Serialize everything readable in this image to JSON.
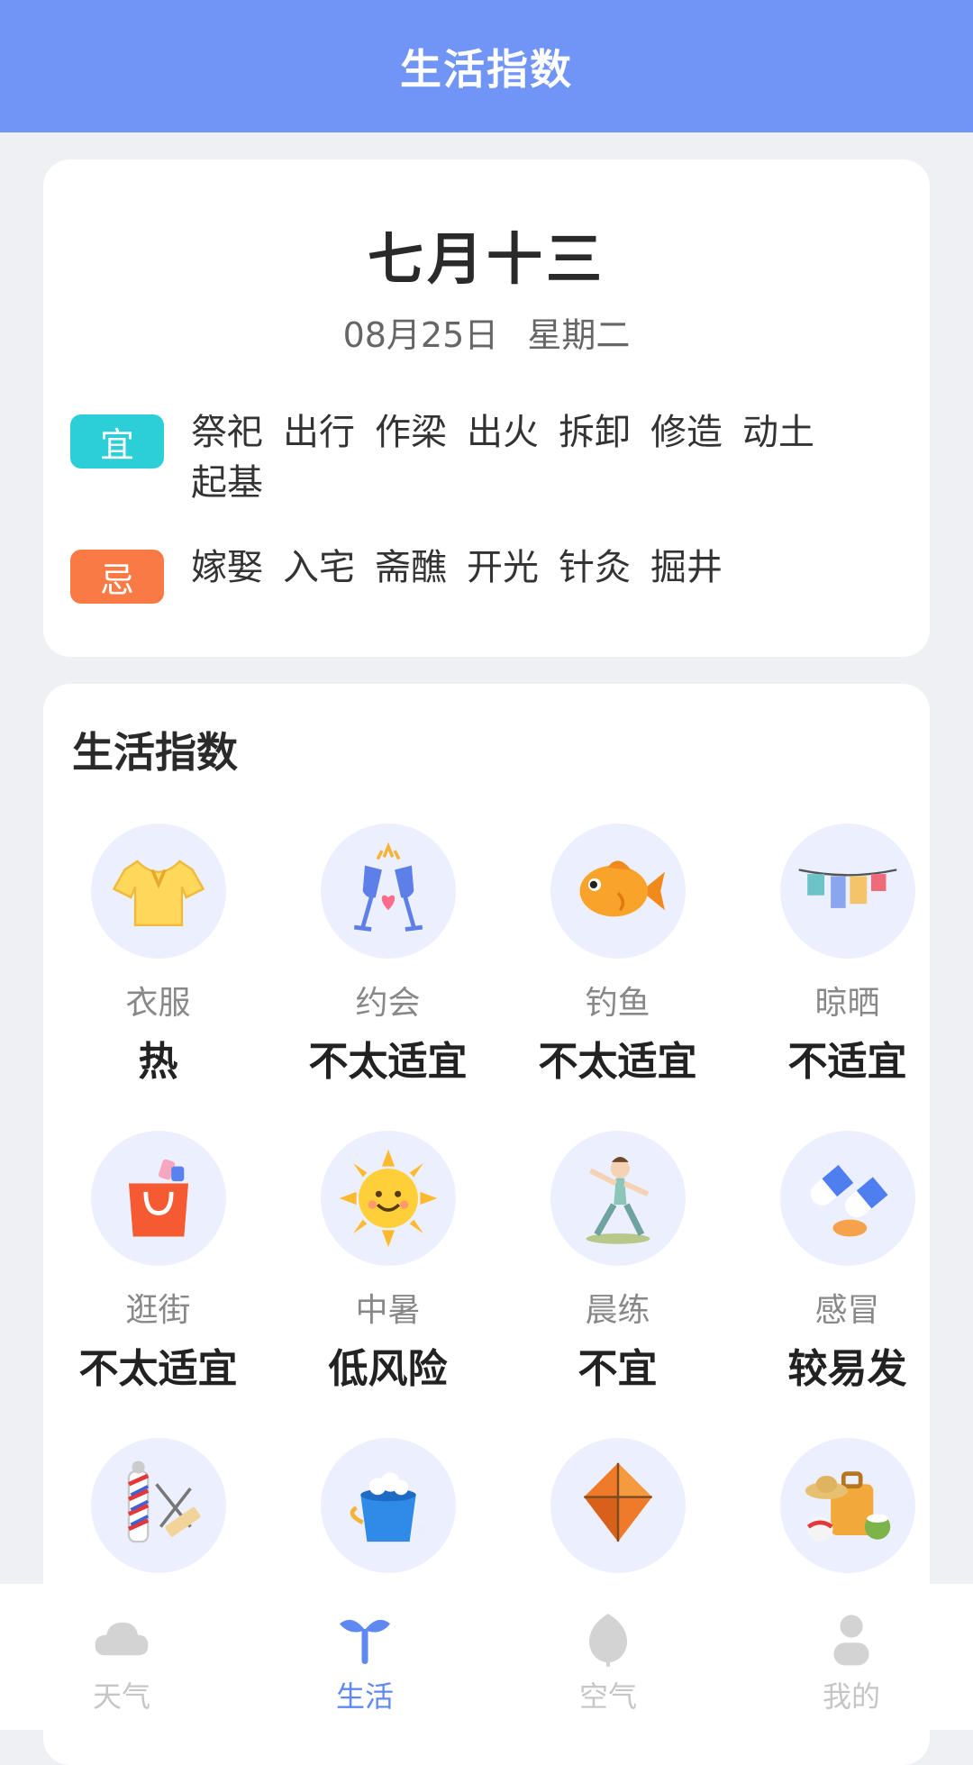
{
  "header": {
    "title": "生活指数"
  },
  "almanac": {
    "lunar_date": "七月十三",
    "solar_date": "08月25日",
    "weekday": "星期二",
    "yi_label": "宜",
    "yi_items": [
      "祭祀",
      "出行",
      "作梁",
      "出火",
      "拆卸",
      "修造",
      "动土",
      "起基"
    ],
    "ji_label": "忌",
    "ji_items": [
      "嫁娶",
      "入宅",
      "斋醮",
      "开光",
      "针灸",
      "掘井"
    ],
    "colors": {
      "yi": "#2ccfd8",
      "ji": "#fa7a45"
    }
  },
  "life": {
    "title": "生活指数",
    "items": [
      {
        "icon": "tshirt-icon",
        "label": "衣服",
        "value": "热"
      },
      {
        "icon": "champagne-glasses-icon",
        "label": "约会",
        "value": "不太适宜"
      },
      {
        "icon": "goldfish-icon",
        "label": "钓鱼",
        "value": "不太适宜"
      },
      {
        "icon": "clothesline-icon",
        "label": "晾晒",
        "value": "不适宜"
      },
      {
        "icon": "shopping-bag-icon",
        "label": "逛街",
        "value": "不太适宜"
      },
      {
        "icon": "sun-icon",
        "label": "中暑",
        "value": "低风险"
      },
      {
        "icon": "yoga-girl-icon",
        "label": "晨练",
        "value": "不宜"
      },
      {
        "icon": "pills-icon",
        "label": "感冒",
        "value": "较易发"
      },
      {
        "icon": "barber-icon",
        "label": "",
        "value": ""
      },
      {
        "icon": "bucket-icon",
        "label": "",
        "value": ""
      },
      {
        "icon": "kite-icon",
        "label": "",
        "value": ""
      },
      {
        "icon": "luggage-icon",
        "label": "",
        "value": ""
      }
    ]
  },
  "tabbar": {
    "tabs": [
      {
        "icon": "cloud-icon",
        "label": "天气"
      },
      {
        "icon": "sprout-icon",
        "label": "生活"
      },
      {
        "icon": "leaf-icon",
        "label": "空气"
      },
      {
        "icon": "person-icon",
        "label": "我的"
      }
    ],
    "active_index": 1
  }
}
